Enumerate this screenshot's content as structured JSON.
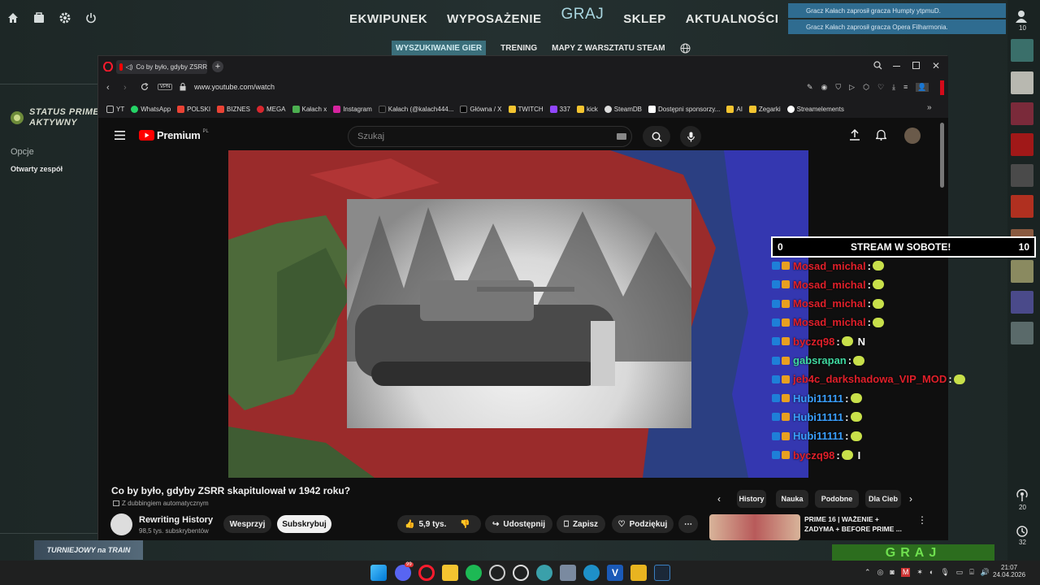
{
  "csgo": {
    "nav": [
      "EKWIPUNEK",
      "WYPOSAŻENIE",
      "GRAJ",
      "SKLEP",
      "AKTUALNOŚCI"
    ],
    "subnav": [
      "WYSZUKIWANIE GIER",
      "TRENING",
      "MAPY Z WARSZTATU STEAM"
    ],
    "notifications": [
      "Gracz Kałach zaprosił gracza Humpty ytpmuD.",
      "Gracz Kałach zaprosił gracza Opera Filharmonia."
    ],
    "prime_line1": "STATUS PRIME",
    "prime_line2": "AKTYWNY",
    "options_label": "Opcje",
    "team_label": "Otwarty zespół",
    "friends_count": "10",
    "count_20": "20",
    "count_32": "32",
    "tournament_label": "TURNIEJOWY na TRAIN",
    "play_button": "GRAJ"
  },
  "browser": {
    "tab_title": "Co by było, gdyby ZSRR",
    "url": "www.youtube.com/watch",
    "vpn_label": "VPN",
    "bookmarks": [
      "YT",
      "WhatsApp",
      "POLSKI",
      "BIZNES",
      "MEGA",
      "Kałach x",
      "Instagram",
      "Kałach (@kalach444...",
      "Główna / X",
      "TWITCH",
      "337",
      "kick",
      "SteamDB",
      "Dostępni sponsorzy...",
      "AI",
      "Zegarki",
      "Streamelements"
    ]
  },
  "youtube": {
    "logo": "Premium",
    "logo_sup": "PL",
    "search_placeholder": "Szukaj",
    "video_title": "Co by było, gdyby ZSRR skapitulował w 1942 roku?",
    "dubbing": "Z dubbingiem automatycznym",
    "channel_name": "Rewriting History",
    "subscribers": "98,5 tys. subskrybentów",
    "support_button": "Wesprzyj",
    "subscribe_button": "Subskrybuj",
    "likes": "5,9 tys.",
    "share_button": "Udostępnij",
    "save_button": "Zapisz",
    "thanks_button": "Podziękuj",
    "chips": [
      "History",
      "Nauka",
      "Podobne",
      "Dla Cieb"
    ],
    "rec_title_1": "PRIME 16 | WAŻENIE +",
    "rec_title_2": "ZADYMA + BEFORE PRIME ..."
  },
  "overlay": {
    "counter": "0",
    "banner": "STREAM W SOBOTE!",
    "count_right": "10",
    "messages": [
      {
        "user": "Mosad_michal",
        "color": "#e0202a",
        "text": ""
      },
      {
        "user": "Mosad_michal",
        "color": "#e0202a",
        "text": ""
      },
      {
        "user": "Mosad_michal",
        "color": "#e0202a",
        "text": ""
      },
      {
        "user": "Mosad_michal",
        "color": "#e0202a",
        "text": ""
      },
      {
        "user": "byczq98",
        "color": "#e0202a",
        "text": "N"
      },
      {
        "user": "gabsrapan",
        "color": "#3fd8a0",
        "text": ""
      },
      {
        "user": "jeb4c_darkshadowa_VIP_MOD",
        "color": "#e0202a",
        "text": ""
      },
      {
        "user": "Hubi11111",
        "color": "#3aa0ff",
        "text": ""
      },
      {
        "user": "Hubi11111",
        "color": "#3aa0ff",
        "text": ""
      },
      {
        "user": "Hubi11111",
        "color": "#3aa0ff",
        "text": ""
      },
      {
        "user": "byczq98",
        "color": "#e0202a",
        "text": "I"
      }
    ]
  },
  "taskbar": {
    "time": "21:07",
    "date": "24.04.2026",
    "discord_badge": "99"
  }
}
